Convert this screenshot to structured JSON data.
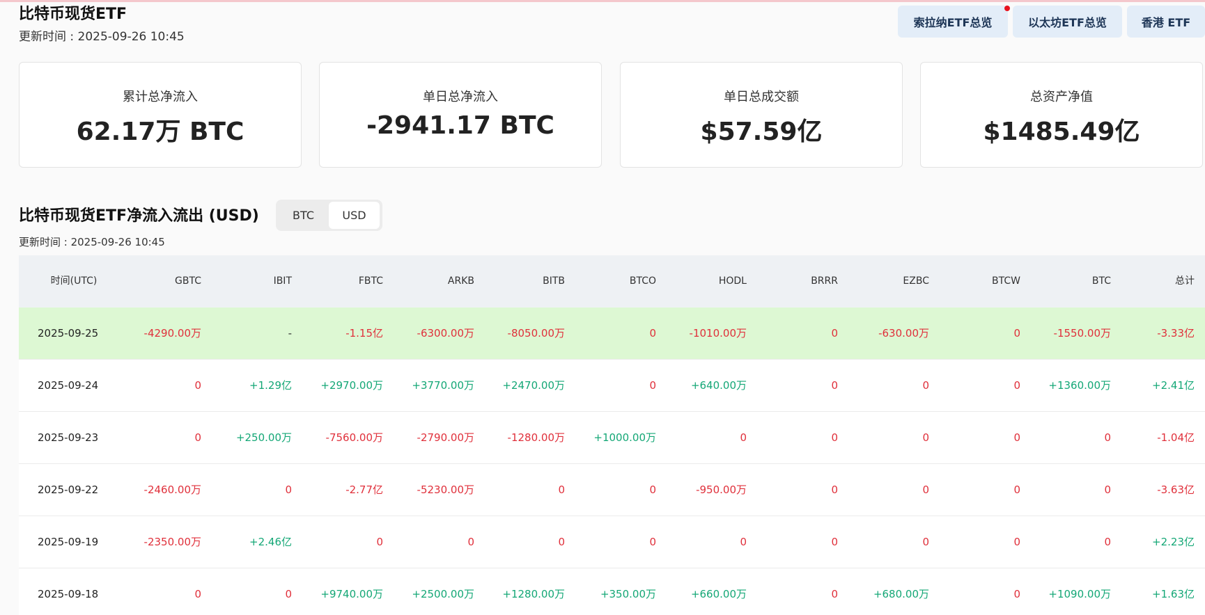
{
  "page": {
    "title": "比特币现货ETF",
    "update_time": "更新时间 : 2025-09-26 10:45"
  },
  "nav": [
    {
      "label": "索拉纳ETF总览"
    },
    {
      "label": "以太坊ETF总览"
    },
    {
      "label": "香港 ETF"
    }
  ],
  "stats": [
    {
      "label": "累计总净流入",
      "value": "62.17万 BTC"
    },
    {
      "label": "单日总净流入",
      "value": "-2941.17 BTC"
    },
    {
      "label": "单日总成交额",
      "value": "$57.59亿"
    },
    {
      "label": "总资产净值",
      "value": "$1485.49亿"
    }
  ],
  "section": {
    "title": "比特币现货ETF净流入流出 (USD)",
    "update_time": "更新时间 : 2025-09-26 10:45",
    "toggle": {
      "options": [
        "BTC",
        "USD"
      ],
      "selected": "USD"
    }
  },
  "colors": {
    "negative": "#e0303b",
    "positive": "#14a776",
    "highlight_row": "#ddf8d3"
  },
  "table": {
    "columns": [
      "时间(UTC)",
      "GBTC",
      "IBIT",
      "FBTC",
      "ARKB",
      "BITB",
      "BTCO",
      "HODL",
      "BRRR",
      "EZBC",
      "BTCW",
      "BTC",
      "总计"
    ],
    "rows": [
      [
        "2025-09-25",
        "-4290.00万",
        "-",
        "-1.15亿",
        "-6300.00万",
        "-8050.00万",
        "0",
        "-1010.00万",
        "0",
        "-630.00万",
        "0",
        "-1550.00万",
        "-3.33亿"
      ],
      [
        "2025-09-24",
        "0",
        "+1.29亿",
        "+2970.00万",
        "+3770.00万",
        "+2470.00万",
        "0",
        "+640.00万",
        "0",
        "0",
        "0",
        "+1360.00万",
        "+2.41亿"
      ],
      [
        "2025-09-23",
        "0",
        "+250.00万",
        "-7560.00万",
        "-2790.00万",
        "-1280.00万",
        "+1000.00万",
        "0",
        "0",
        "0",
        "0",
        "0",
        "-1.04亿"
      ],
      [
        "2025-09-22",
        "-2460.00万",
        "0",
        "-2.77亿",
        "-5230.00万",
        "0",
        "0",
        "-950.00万",
        "0",
        "0",
        "0",
        "0",
        "-3.63亿"
      ],
      [
        "2025-09-19",
        "-2350.00万",
        "+2.46亿",
        "0",
        "0",
        "0",
        "0",
        "0",
        "0",
        "0",
        "0",
        "0",
        "+2.23亿"
      ],
      [
        "2025-09-18",
        "0",
        "0",
        "+9740.00万",
        "+2500.00万",
        "+1280.00万",
        "+350.00万",
        "+660.00万",
        "0",
        "+680.00万",
        "0",
        "+1090.00万",
        "+1.63亿"
      ]
    ]
  }
}
